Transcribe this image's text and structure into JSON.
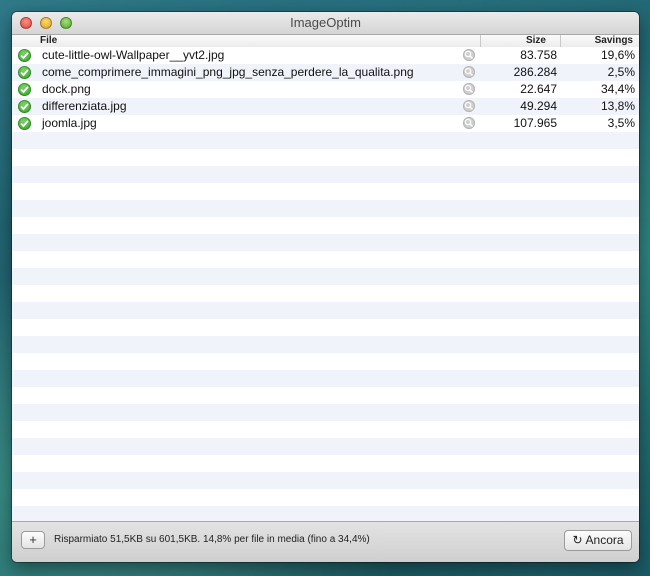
{
  "window": {
    "title": "ImageOptim"
  },
  "columns": {
    "file": "File",
    "size": "Size",
    "savings": "Savings"
  },
  "files": [
    {
      "name": "cute-little-owl-Wallpaper__yvt2.jpg",
      "size": "83.758",
      "savings": "19,6%"
    },
    {
      "name": "come_comprimere_immagini_png_jpg_senza_perdere_la_qualita.png",
      "size": "286.284",
      "savings": "2,5%"
    },
    {
      "name": "dock.png",
      "size": "22.647",
      "savings": "34,4%"
    },
    {
      "name": "differenziata.jpg",
      "size": "49.294",
      "savings": "13,8%"
    },
    {
      "name": "joomla.jpg",
      "size": "107.965",
      "savings": "3,5%"
    }
  ],
  "footer": {
    "add_label": "+",
    "status": "Risparmiato 51,5KB su 601,5KB. 14,8% per file in media (fino a 34,4%)",
    "again_label": "Ancora",
    "again_icon": "refresh-icon"
  },
  "colors": {
    "check": "#2f9a22",
    "stripe": "#f0f4fa"
  }
}
